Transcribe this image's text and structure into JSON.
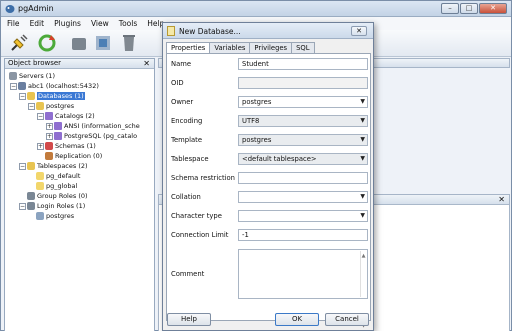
{
  "window": {
    "title": "pgAdmin",
    "min_label": "–",
    "max_label": "□",
    "close_label": "✕"
  },
  "menu": [
    "File",
    "Edit",
    "Plugins",
    "View",
    "Tools",
    "Help"
  ],
  "object_browser": {
    "title": "Object browser",
    "close_label": "✕",
    "tree": [
      {
        "label": "Servers (1)",
        "indent": 0,
        "icon": "servers-icon",
        "exp": ""
      },
      {
        "label": "abc1 (localhost:5432)",
        "indent": 1,
        "icon": "server-icon",
        "exp": "−"
      },
      {
        "label": "Databases (1)",
        "indent": 2,
        "icon": "databases-icon",
        "exp": "−",
        "selected": true
      },
      {
        "label": "postgres",
        "indent": 3,
        "icon": "database-icon",
        "exp": "−"
      },
      {
        "label": "Catalogs (2)",
        "indent": 4,
        "icon": "catalogs-icon",
        "exp": "−"
      },
      {
        "label": "ANSI (information_sche",
        "indent": 5,
        "icon": "catalog-icon",
        "exp": "+"
      },
      {
        "label": "PostgreSQL (pg_catalo",
        "indent": 5,
        "icon": "catalog-icon",
        "exp": "+"
      },
      {
        "label": "Schemas (1)",
        "indent": 4,
        "icon": "schemas-icon",
        "exp": "+"
      },
      {
        "label": "Replication (0)",
        "indent": 4,
        "icon": "replication-icon",
        "exp": ""
      },
      {
        "label": "Tablespaces (2)",
        "indent": 2,
        "icon": "tablespaces-icon",
        "exp": "−"
      },
      {
        "label": "pg_default",
        "indent": 3,
        "icon": "tablespace-icon",
        "exp": ""
      },
      {
        "label": "pg_global",
        "indent": 3,
        "icon": "tablespace-icon",
        "exp": ""
      },
      {
        "label": "Group Roles (0)",
        "indent": 2,
        "icon": "group-roles-icon",
        "exp": ""
      },
      {
        "label": "Login Roles (1)",
        "indent": 2,
        "icon": "login-roles-icon",
        "exp": "−"
      },
      {
        "label": "postgres",
        "indent": 3,
        "icon": "user-icon",
        "exp": ""
      }
    ]
  },
  "sql_pane": {
    "close_label": "✕"
  },
  "dialog": {
    "title": "New Database...",
    "close_label": "✕",
    "tabs": [
      "Properties",
      "Variables",
      "Privileges",
      "SQL"
    ],
    "fields": {
      "name": {
        "label": "Name",
        "value": "Student"
      },
      "oid": {
        "label": "OID",
        "value": ""
      },
      "owner": {
        "label": "Owner",
        "value": "postgres"
      },
      "encoding": {
        "label": "Encoding",
        "value": "UTF8"
      },
      "template": {
        "label": "Template",
        "value": "postgres"
      },
      "tablespace": {
        "label": "Tablespace",
        "value": "<default tablespace>"
      },
      "schema_restriction": {
        "label": "Schema restriction",
        "value": ""
      },
      "collation": {
        "label": "Collation",
        "value": ""
      },
      "character_type": {
        "label": "Character type",
        "value": ""
      },
      "connection_limit": {
        "label": "Connection Limit",
        "value": "-1"
      },
      "comment": {
        "label": "Comment",
        "value": ""
      }
    },
    "buttons": {
      "help": "Help",
      "ok": "OK",
      "cancel": "Cancel"
    }
  }
}
